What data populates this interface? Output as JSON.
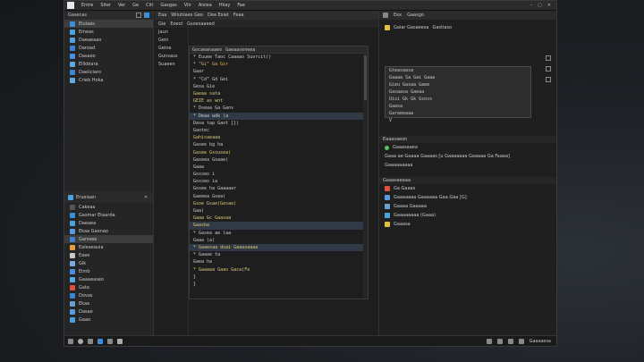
{
  "menu": {
    "items": [
      "Entre",
      "Siter",
      "Ver",
      "Ge",
      "Ciit",
      "Gasgas",
      "Viir",
      "Aislea",
      "Hiiay",
      "Fae"
    ]
  },
  "window_controls": [
    "–",
    "▢",
    "✕"
  ],
  "left_panel": {
    "title": "Gasecas",
    "items": [
      {
        "label": "Eiuiaas",
        "color": "#3a8fd8"
      },
      {
        "label": "Emeas",
        "color": "#4aa3df"
      },
      {
        "label": "Daeaeaao",
        "color": "#5aa0d8"
      },
      {
        "label": "Daroad",
        "color": "#3f7fd0"
      },
      {
        "label": "Dasaeo",
        "color": "#4a90e0"
      },
      {
        "label": "Elikbiara",
        "color": "#5ba8e8"
      },
      {
        "label": "Daeiiciaro",
        "color": "#3d86cf"
      },
      {
        "label": "Crieb Hoka",
        "color": "#66a8e0"
      }
    ]
  },
  "left_panel_2": {
    "title": "Erueiaan",
    "items": [
      {
        "label": "Cakeaa",
        "color": "#555"
      },
      {
        "label": "Gasmar Etaarda",
        "color": "#3a8fd8"
      },
      {
        "label": "Daeaea",
        "color": "#4aa3df"
      },
      {
        "label": "Ekaa Gaenao",
        "color": "#5a9ae0"
      },
      {
        "label": "Garssee",
        "color": "#3f7fd0"
      },
      {
        "label": "Ealeaeauia",
        "color": "#e0a040"
      },
      {
        "label": "Eaee",
        "color": "#c8c8c8"
      },
      {
        "label": "Gik",
        "color": "#7aa8e0"
      },
      {
        "label": "Eimb",
        "color": "#4a90e0"
      },
      {
        "label": "Gaaaeaseo",
        "color": "#5ba8e8"
      },
      {
        "label": "Gata",
        "color": "#e05040"
      },
      {
        "label": "Dovas",
        "color": "#3d86cf"
      },
      {
        "label": "Ekaa",
        "color": "#6aa0d0"
      },
      {
        "label": "Dasae",
        "color": "#5a9ae0"
      },
      {
        "label": "Gaao",
        "color": "#4aa0e0"
      }
    ]
  },
  "center_top": {
    "labels": [
      "Eaa",
      "Wiiuhiaes Geo",
      "Dea Esiet",
      "Feaa"
    ]
  },
  "center_tabs": {
    "labels": [
      "Gie",
      "Eoeol",
      "Gsoesaaeed"
    ]
  },
  "gutter_items": [
    "Jaun",
    "Gein",
    "Geine",
    "Gunsaus",
    "Suaeen"
  ],
  "editor": {
    "tab_labels": [
      "Gocaeanaaeo",
      "Gaeaaseneea"
    ],
    "lines": [
      {
        "t": "* Euuee Taoc Caaaao Suvrcit()",
        "c": "plain"
      },
      {
        "t": "* \"Gi\" Ga Gsr",
        "c": "kw"
      },
      {
        "t": "Gaar",
        "c": "plain"
      },
      {
        "t": "  * \"Cd\" Gd Gei",
        "c": "plain"
      },
      {
        "t": "  Gesa Gie",
        "c": "plain"
      },
      {
        "t": "  Gaeaa sata",
        "c": "str"
      },
      {
        "t": "  GEIE as wnt",
        "c": "str"
      },
      {
        "t": "* Dseaa Ga Ganv",
        "c": "plain"
      },
      {
        "t": "* Deaa wdk (a",
        "c": "plain"
      },
      {
        "t": "  Dasa tap Gaot [})",
        "c": "plain"
      },
      {
        "t": "  Gaotec",
        "c": "plain"
      },
      {
        "t": "  Gahisaeaaa",
        "c": "str"
      },
      {
        "t": "  Gasee bg ha",
        "c": "plain"
      },
      {
        "t": "  Gasee Gxsusea(",
        "c": "str"
      },
      {
        "t": "  Gaseea Gsaae(",
        "c": "plain"
      },
      {
        "t": "  Gaaa",
        "c": "plain"
      },
      {
        "t": "  Gosseo i",
        "c": "plain"
      },
      {
        "t": "  Gosseo ia",
        "c": "plain"
      },
      {
        "t": "  Gosee ha Gaaaaar",
        "c": "plain"
      },
      {
        "t": "  Gaeeea Gsea(",
        "c": "plain"
      },
      {
        "t": "  Gsoe Gsae(Gesae)",
        "c": "str"
      },
      {
        "t": "  Gaa(",
        "c": "plain"
      },
      {
        "t": "  Gaaa Gc Gaasaa",
        "c": "str"
      },
      {
        "t": "  Gaasba",
        "c": "str"
      },
      {
        "t": "* Gasea ae laa",
        "c": "plain"
      },
      {
        "t": "  Gaaa (a)",
        "c": "plain"
      },
      {
        "t": "* Gaaesaa dsai Gaaasaaaa",
        "c": "str"
      },
      {
        "t": "* Gaaae ta",
        "c": "plain"
      },
      {
        "t": "  Gaea ha",
        "c": "plain"
      },
      {
        "t": "* Gaaaaa Gaao Gaca(Fe",
        "c": "str"
      },
      {
        "t": "  }",
        "c": "plain"
      },
      {
        "t": "  }",
        "c": "plain"
      }
    ]
  },
  "right_panel": {
    "header": [
      "Eex",
      "Gaasgo"
    ],
    "row1": [
      "Gaiar Gasaeesa",
      "Gastiaso"
    ],
    "popup_lines": [
      "Gteasaasa",
      "Gaaaa Sa Gai Gaaa",
      "Gieu Gasaa Gaee",
      "Gasaasa Gaeaa",
      "Uisi Gk Gk Gsoss",
      "Gaasa",
      "Garaeeaaa",
      "V"
    ],
    "section1_title": "Eaaasaeon",
    "section1_rows": [
      "Gaaasaaea",
      "Gaaa ae Gaaaa Gaaaas [u Gaaaaaaa Gaaaaa Ga Faaaa]",
      "Gaaaaaaaaa"
    ],
    "section2_title": "Gaaasaeaaa",
    "section2_rows": [
      {
        "label": "Ga Gaaas",
        "color": "#e05040"
      },
      {
        "label": "Gaaaaaaa Gaaaaaa Gaa Gaa [G]",
        "color": "#5a9ae0"
      },
      {
        "label": "Gaaaa Gaaaaa",
        "color": "#6aa0d0"
      },
      {
        "label": "Gaaaaaaaa (Gaaa)",
        "color": "#4aa3df"
      },
      {
        "label": "Gaaasa",
        "color": "#e0c040"
      }
    ]
  },
  "statusbar": {
    "right_text": "Gaasaesa"
  },
  "colors": {
    "accent": "#3a8fd8",
    "highlight": "#2f3a46"
  }
}
